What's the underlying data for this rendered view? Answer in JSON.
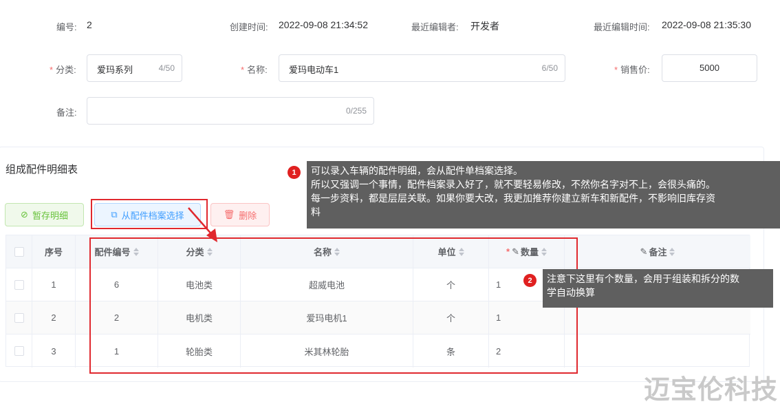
{
  "info": {
    "id_label": "编号:",
    "id_value": "2",
    "created_label": "创建时间:",
    "created_value": "2022-09-08 21:34:52",
    "editor_label": "最近编辑者:",
    "editor_value": "开发者",
    "edited_label": "最近编辑时间:",
    "edited_value": "2022-09-08 21:35:30"
  },
  "form": {
    "category_label": "分类:",
    "category_value": "爱玛系列",
    "category_count": "4/50",
    "name_label": "名称:",
    "name_value": "爱玛电动车1",
    "name_count": "6/50",
    "price_label": "销售价:",
    "price_value": "5000",
    "remark_label": "备注:",
    "remark_value": "",
    "remark_count": "0/255",
    "required_mark": "*"
  },
  "section": {
    "title": "组成配件明细表",
    "save_label": "暂存明细",
    "select_label": "从配件档案选择",
    "delete_label": "删除"
  },
  "table": {
    "headers": {
      "seq": "序号",
      "part_no": "配件编号",
      "category": "分类",
      "name": "名称",
      "unit": "单位",
      "qty": "数量",
      "remark": "备注"
    },
    "rows": [
      {
        "seq": "1",
        "part_no": "6",
        "category": "电池类",
        "name": "超威电池",
        "unit": "个",
        "qty": "1",
        "remark": ""
      },
      {
        "seq": "2",
        "part_no": "2",
        "category": "电机类",
        "name": "爱玛电机1",
        "unit": "个",
        "qty": "1",
        "remark": ""
      },
      {
        "seq": "3",
        "part_no": "1",
        "category": "轮胎类",
        "name": "米其林轮胎",
        "unit": "条",
        "qty": "2",
        "remark": ""
      }
    ]
  },
  "annotations": {
    "badge1": "1",
    "tip1_line1": "可以录入车辆的配件明细，会从配件单档案选择。",
    "tip1_line2": "所以又强调一个事情，配件档案录入好了，就不要轻易修改，不然你名字对不上，会很头痛的。",
    "tip1_line3": "每一步资料，都是层层关联。如果你要大改，我更加推荐你建立新车和新配件，不影响旧库存资",
    "tip1_line4": "料",
    "badge2": "2",
    "tip2_line1": "注意下这里有个数量，会用于组装和拆分的数",
    "tip2_line2": "学自动换算"
  },
  "watermark": "迈宝伦科技",
  "colors": {
    "save_green": "#67c23a",
    "select_blue": "#409eff",
    "delete_red": "#f56c6c",
    "annotation_red": "#e0282e",
    "tooltip_bg": "#5f5f5f"
  }
}
